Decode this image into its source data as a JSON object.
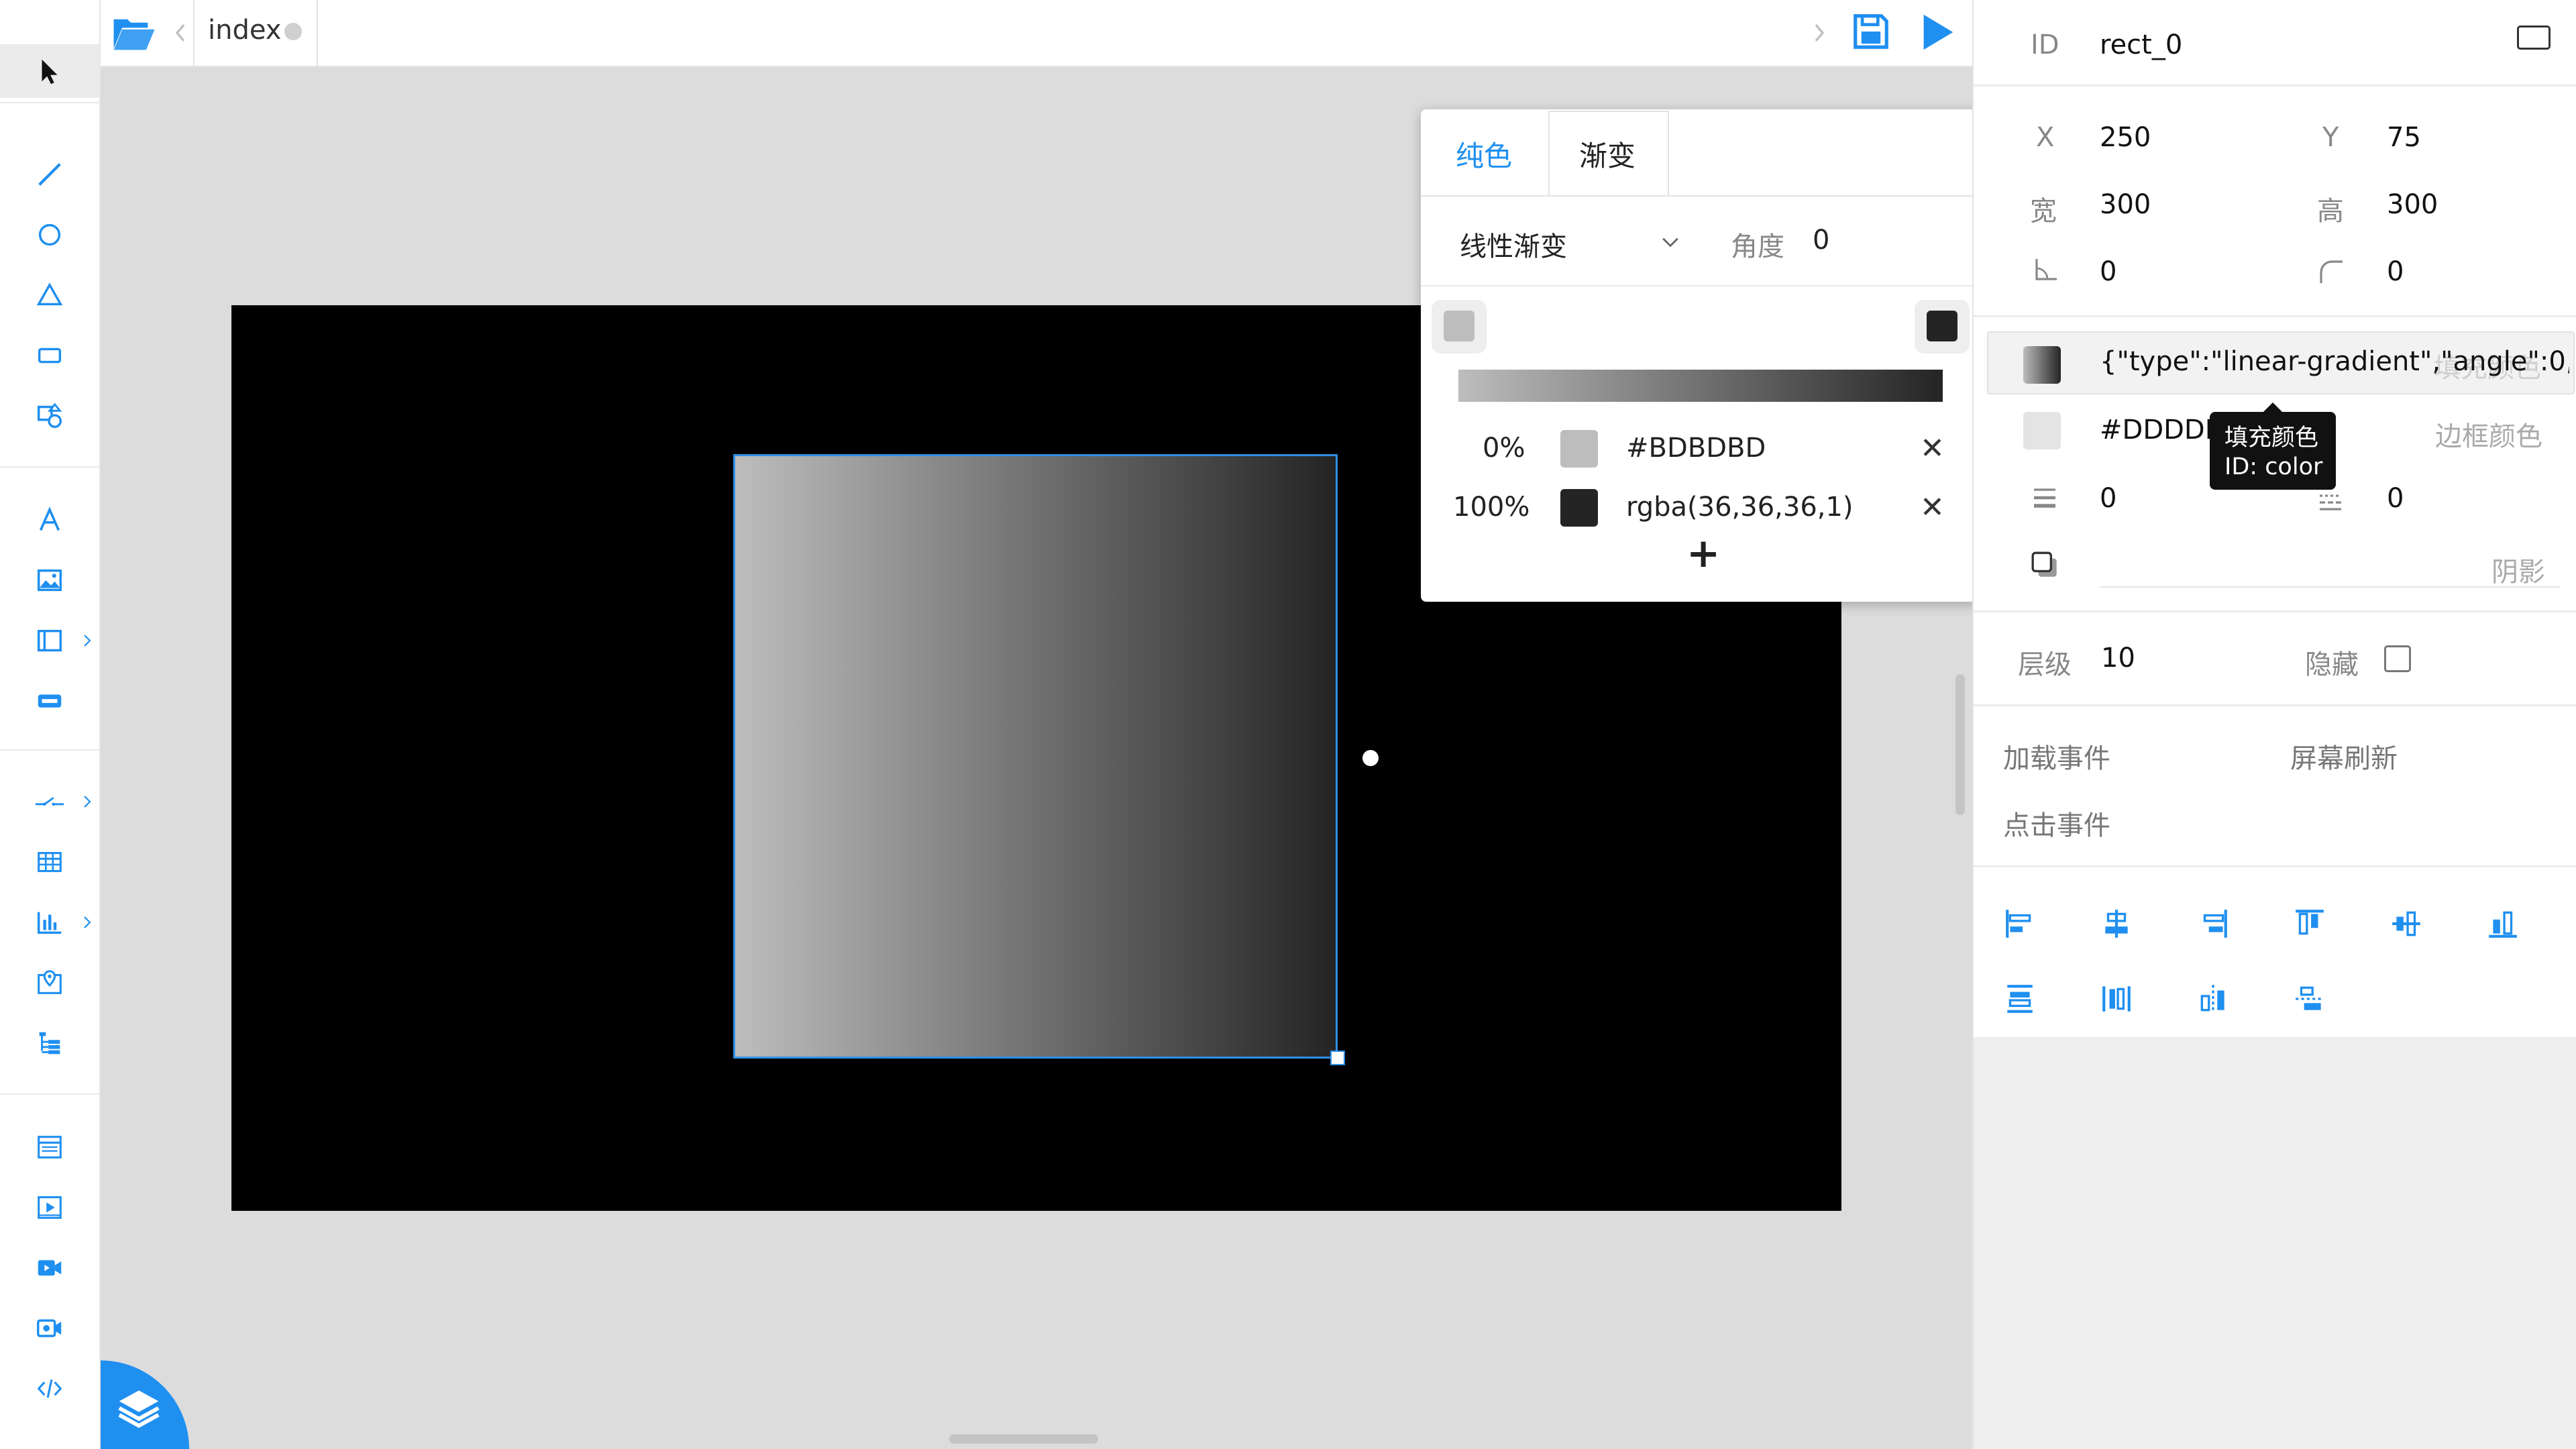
{
  "topbar": {
    "tab_name": "index"
  },
  "left_toolbar": {
    "tools": [
      {
        "icon": "cursor-icon"
      },
      {
        "icon": "line-icon"
      },
      {
        "icon": "circle-icon"
      },
      {
        "icon": "triangle-icon"
      },
      {
        "icon": "rectangle-icon"
      },
      {
        "icon": "shapes-icon"
      },
      {
        "icon": "text-icon"
      },
      {
        "icon": "image-icon"
      },
      {
        "icon": "frame-icon"
      },
      {
        "icon": "button-icon"
      },
      {
        "icon": "switch-icon"
      },
      {
        "icon": "table-icon"
      },
      {
        "icon": "chart-icon"
      },
      {
        "icon": "map-icon"
      },
      {
        "icon": "tree-icon"
      },
      {
        "icon": "page-icon"
      },
      {
        "icon": "play-media-icon"
      },
      {
        "icon": "video-icon"
      },
      {
        "icon": "camera-icon"
      },
      {
        "icon": "code-icon"
      }
    ]
  },
  "popup": {
    "tabs": [
      "纯色",
      "渐变"
    ],
    "active_tab": "渐变",
    "gradient_type": "线性渐变",
    "angle_label": "角度",
    "angle_value": "0",
    "stops": [
      {
        "offset": "0%",
        "color": "#BDBDBD",
        "swatch": "#BDBDBD"
      },
      {
        "offset": "100%",
        "color": "rgba(36,36,36,1)",
        "swatch": "#242424"
      }
    ],
    "add_symbol": "+",
    "remove_symbol": "✕"
  },
  "properties": {
    "id_label": "ID",
    "id_value": "rect_0",
    "x_label": "X",
    "x_value": "250",
    "y_label": "Y",
    "y_value": "75",
    "w_label": "宽",
    "w_value": "300",
    "h_label": "高",
    "h_value": "300",
    "rotate_value": "0",
    "radius_value": "0",
    "fill_value": "{\"type\":\"linear-gradient\",\"angle\":0,\"",
    "fill_placeholder": "填充颜色",
    "border_color_value": "#DDDDD",
    "border_color_placeholder": "边框颜色",
    "border_width_value": "0",
    "border_style_value": "0",
    "shadow_placeholder": "阴影",
    "tooltip_line1": "填充颜色",
    "tooltip_line2": "ID: color",
    "layer_label": "层级",
    "layer_value": "10",
    "hidden_label": "隐藏",
    "load_event": "加载事件",
    "refresh_event": "屏幕刷新",
    "click_event": "点击事件"
  },
  "colors": {
    "accent": "#1f8ff0",
    "selection": "#2f8fe6",
    "canvas_bg": "#dcdcdc"
  }
}
